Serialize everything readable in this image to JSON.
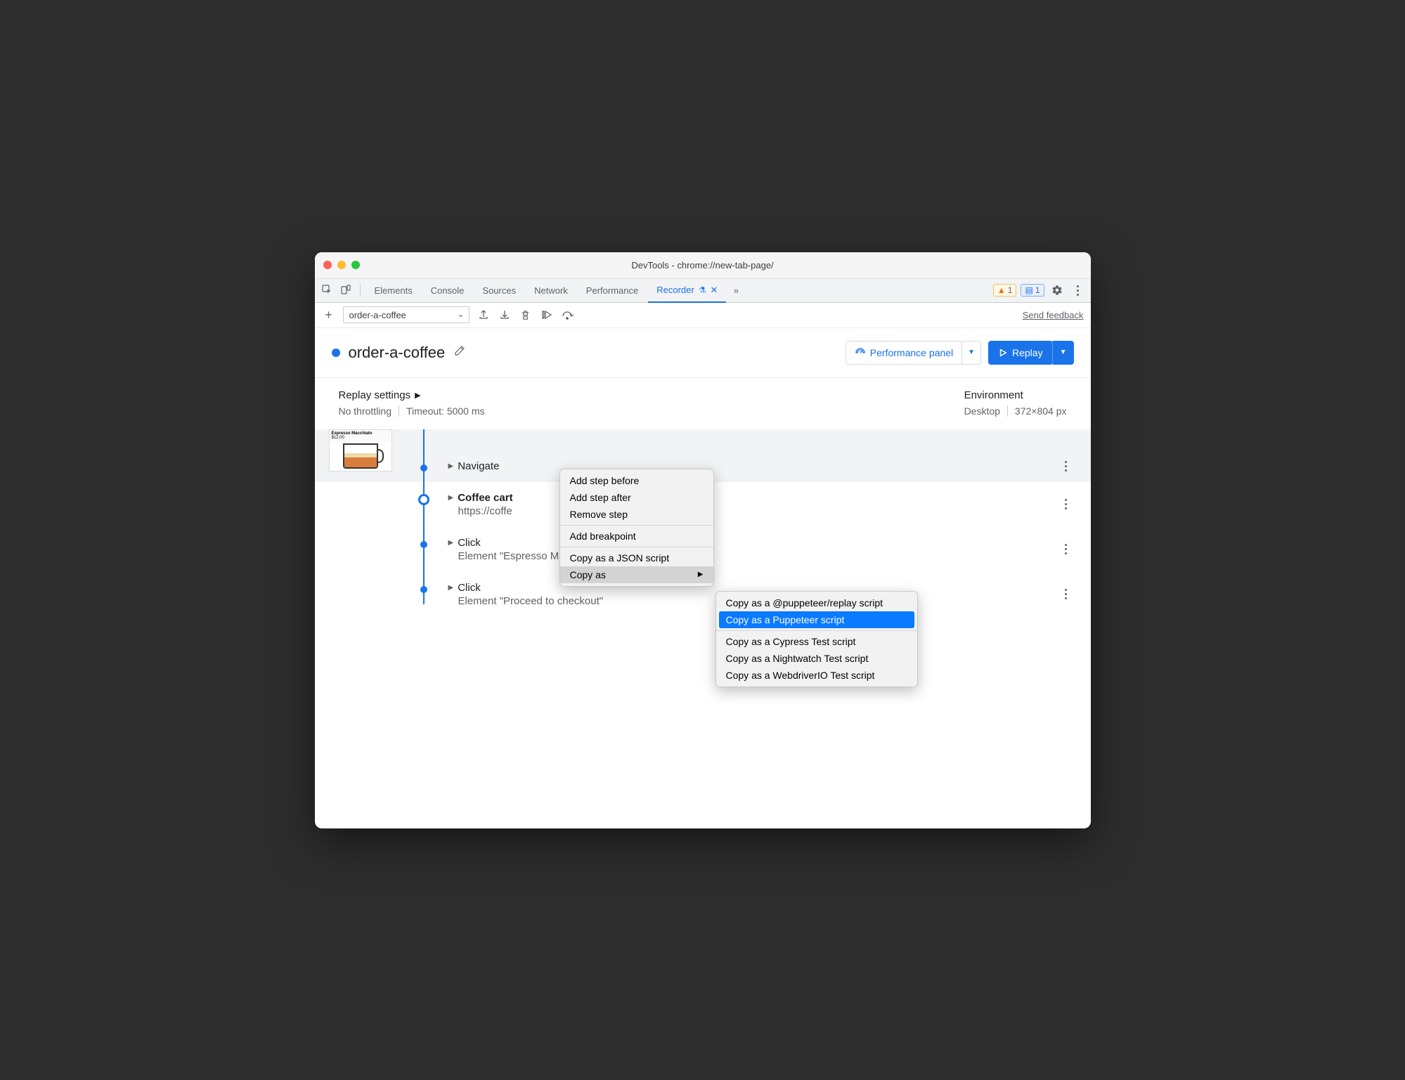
{
  "window": {
    "title": "DevTools - chrome://new-tab-page/"
  },
  "tabs": {
    "items": [
      "Elements",
      "Console",
      "Sources",
      "Network",
      "Performance"
    ],
    "recorder": "Recorder",
    "warn_count": "1",
    "msg_count": "1"
  },
  "toolbar": {
    "recording_name": "order-a-coffee",
    "feedback": "Send feedback"
  },
  "header": {
    "title": "order-a-coffee",
    "perf_button": "Performance panel",
    "replay_button": "Replay"
  },
  "settings": {
    "replay_heading": "Replay settings",
    "throttling": "No throttling",
    "timeout": "Timeout: 5000 ms",
    "env_heading": "Environment",
    "device": "Desktop",
    "dimensions": "372×804 px"
  },
  "thumb": {
    "name": "Espresso Macchiato",
    "price": "$12.00"
  },
  "steps": [
    {
      "title": "Navigate",
      "sub": ""
    },
    {
      "title": "Coffee cart",
      "sub": "https://coffe",
      "bold": true
    },
    {
      "title": "Click",
      "sub": "Element \"Espresso Macchiato\""
    },
    {
      "title": "Click",
      "sub": "Element \"Proceed to checkout\""
    }
  ],
  "context1": {
    "add_before": "Add step before",
    "add_after": "Add step after",
    "remove": "Remove step",
    "breakpoint": "Add breakpoint",
    "copy_json": "Copy as a JSON script",
    "copy_as": "Copy as"
  },
  "context2": {
    "replay": "Copy as a @puppeteer/replay script",
    "puppeteer": "Copy as a Puppeteer script",
    "cypress": "Copy as a Cypress Test script",
    "nightwatch": "Copy as a Nightwatch Test script",
    "webdriverio": "Copy as a WebdriverIO Test script"
  }
}
